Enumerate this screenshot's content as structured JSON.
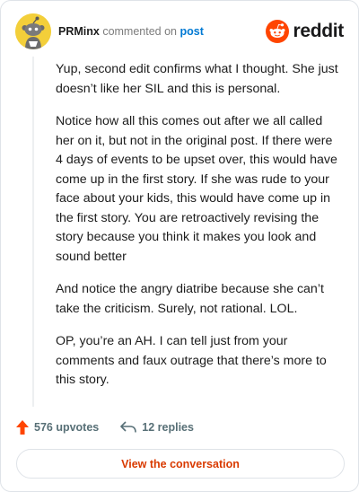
{
  "header": {
    "username": "PRMinx",
    "verb": " commented on ",
    "post_link": "post",
    "brand": "reddit"
  },
  "comment": {
    "paragraphs": [
      "Yup, second edit confirms what I thought. She just doesn’t like her SIL and this is personal.",
      "Notice how all this comes out after we all called her on it, but not in the original post. If there were 4 days of events to be upset over, this would have come up in the first story. If she was rude to your face about your kids, this would have come up in the first story. You are retroactively revising the story because you think it makes you look and sound better",
      "And notice the angry diatribe because she can’t take the criticism. Surely, not rational. LOL.",
      "OP, you’re an AH. I can tell just from your comments and faux outrage that there’s more to this story."
    ]
  },
  "actions": {
    "upvotes": "576 upvotes",
    "replies": "12 replies"
  },
  "cta": {
    "label": "View the conversation"
  },
  "colors": {
    "accent": "#d93a00",
    "link": "#0079d3",
    "upvote": "#ff4500",
    "muted": "#576f76"
  },
  "icons": [
    "snoo-avatar-icon",
    "reddit-logo-icon",
    "upvote-arrow-icon",
    "reply-arrow-icon"
  ]
}
